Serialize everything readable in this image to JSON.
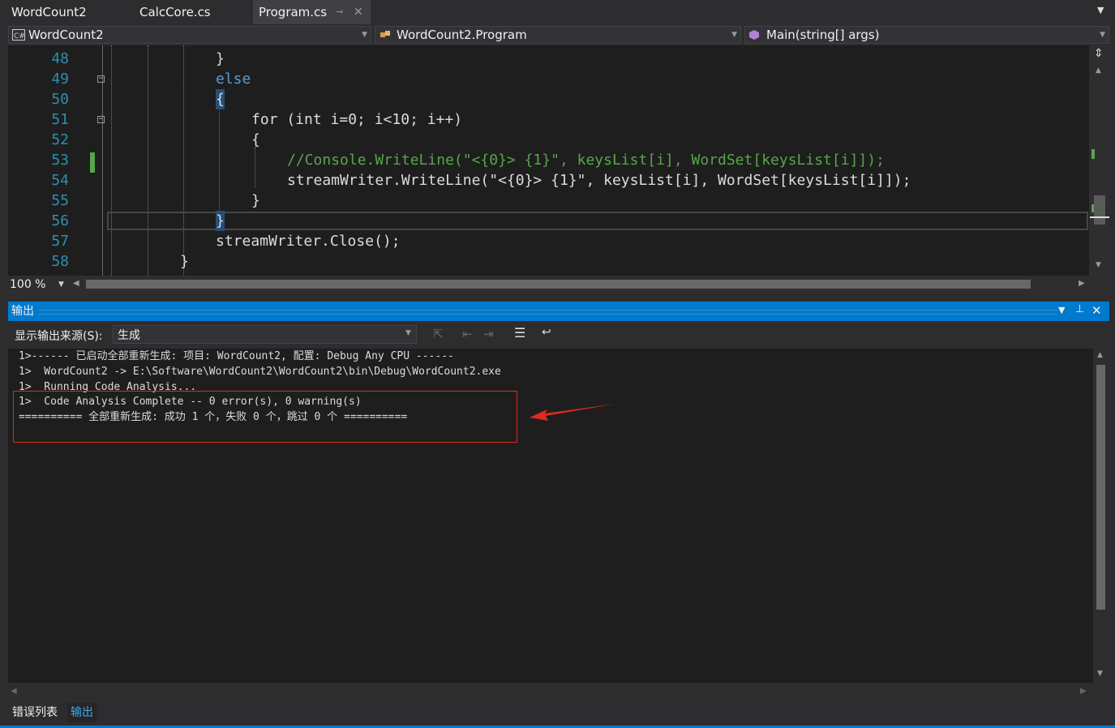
{
  "tabs": [
    {
      "label": "WordCount2"
    },
    {
      "label": "CalcCore.cs"
    },
    {
      "label": "Program.cs",
      "active": true
    }
  ],
  "nav": {
    "project": "WordCount2",
    "class": "WordCount2.Program",
    "member": "Main(string[] args)"
  },
  "editor": {
    "lines": [
      {
        "num": "48",
        "code": "}"
      },
      {
        "num": "49",
        "code": "else"
      },
      {
        "num": "50",
        "code": "{"
      },
      {
        "num": "51",
        "code": "for (int i=0; i<10; i++)"
      },
      {
        "num": "52",
        "code": "{"
      },
      {
        "num": "53",
        "code": "//Console.WriteLine(\"<{0}> {1}\", keysList[i], WordSet[keysList[i]]);"
      },
      {
        "num": "54",
        "code": "streamWriter.WriteLine(\"<{0}> {1}\", keysList[i], WordSet[keysList[i]]);"
      },
      {
        "num": "55",
        "code": "}"
      },
      {
        "num": "56",
        "code": "}"
      },
      {
        "num": "57",
        "code": "streamWriter.Close();"
      },
      {
        "num": "58",
        "code": "}"
      }
    ],
    "zoom": "100 %"
  },
  "output": {
    "title": "输出",
    "source_label": "显示输出来源(S):",
    "source_value": "生成",
    "lines": [
      "1>------ 已启动全部重新生成: 项目: WordCount2, 配置: Debug Any CPU ------",
      "1>  WordCount2 -> E:\\Software\\WordCount2\\WordCount2\\bin\\Debug\\WordCount2.exe",
      "1>  Running Code Analysis...",
      "1>  Code Analysis Complete -- 0 error(s), 0 warning(s)",
      "========== 全部重新生成: 成功 1 个，失败 0 个，跳过 0 个 =========="
    ]
  },
  "bottom_tabs": [
    {
      "label": "错误列表"
    },
    {
      "label": "输出",
      "active": true
    }
  ],
  "colors": {
    "accent": "#007acc",
    "annotation": "#e0291f"
  }
}
